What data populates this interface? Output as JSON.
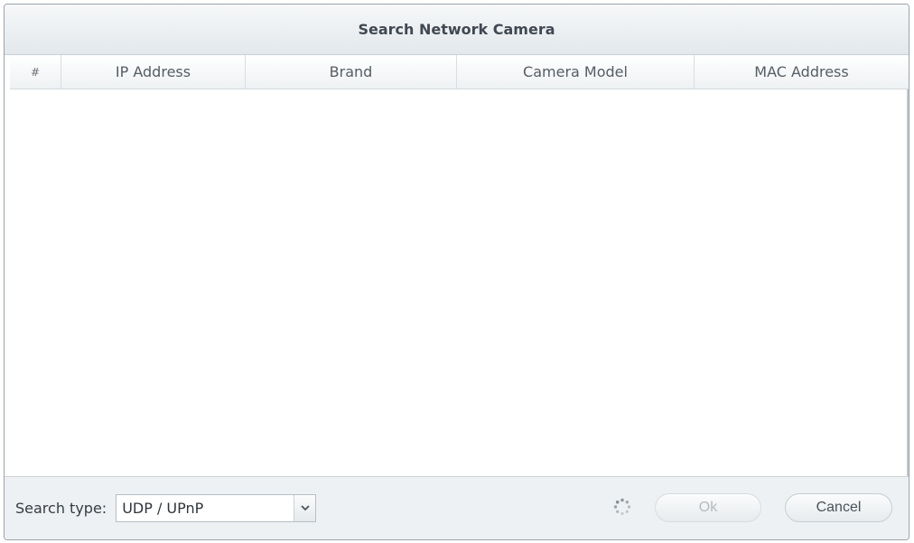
{
  "dialog": {
    "title": "Search Network Camera"
  },
  "table": {
    "columns": [
      "#",
      "IP Address",
      "Brand",
      "Camera Model",
      "MAC Address"
    ],
    "rows": []
  },
  "footer": {
    "search_type_label": "Search type:",
    "search_type_value": "UDP / UPnP",
    "ok_label": "Ok",
    "cancel_label": "Cancel",
    "ok_enabled": false
  },
  "icons": {
    "spinner": "loading-spinner-icon",
    "dropdown": "chevron-down-icon"
  },
  "colors": {
    "title_text": "#404851",
    "footer_bg": "#eef1f3",
    "disabled_text": "#b4babf"
  }
}
